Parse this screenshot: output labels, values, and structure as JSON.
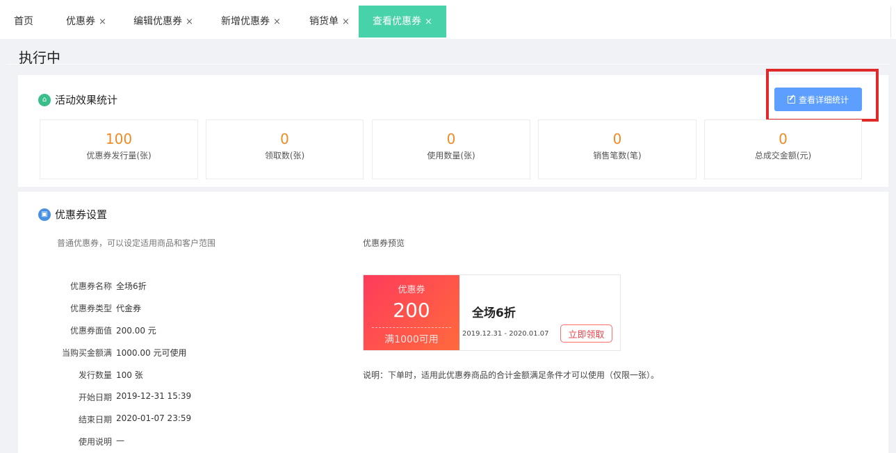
{
  "tabs": [
    {
      "label": "首页",
      "closable": false,
      "active": false
    },
    {
      "label": "优惠券",
      "closable": true,
      "active": false
    },
    {
      "label": "编辑优惠券",
      "closable": true,
      "active": false
    },
    {
      "label": "新增优惠券",
      "closable": true,
      "active": false
    },
    {
      "label": "销货单",
      "closable": true,
      "active": false
    },
    {
      "label": "查看优惠券",
      "closable": true,
      "active": true
    }
  ],
  "close_glyph": "×",
  "page_title": "执行中",
  "stats_section": {
    "title": "活动效果统计",
    "icon": "home-icon",
    "detail_button_label": "查看详细统计",
    "items": [
      {
        "value": "100",
        "label": "优惠券发行量(张)"
      },
      {
        "value": "0",
        "label": "领取数(张)"
      },
      {
        "value": "0",
        "label": "使用数量(张)"
      },
      {
        "value": "0",
        "label": "销售笔数(笔)"
      },
      {
        "value": "0",
        "label": "总成交金额(元)"
      }
    ]
  },
  "settings_section": {
    "title": "优惠券设置",
    "icon": "coupon-icon",
    "description": "普通优惠券，可以设定适用商品和客户范围",
    "preview_label": "优惠券预览",
    "fields": [
      {
        "key": "优惠券名称",
        "value": "全场6折"
      },
      {
        "key": "优惠券类型",
        "value": "代金券"
      },
      {
        "key": "优惠券面值",
        "value": "200.00 元"
      },
      {
        "key": "当购买金额满",
        "value": "1000.00 元可使用"
      },
      {
        "key": "发行数量",
        "value": "100 张"
      },
      {
        "key": "开始日期",
        "value": "2019-12-31 15:39"
      },
      {
        "key": "结束日期",
        "value": "2020-01-07 23:59"
      },
      {
        "key": "使用说明",
        "value": "—"
      }
    ]
  },
  "coupon_preview": {
    "tag": "优惠券",
    "amount": "200",
    "condition": "满1000可用",
    "name": "全场6折",
    "date_range": "2019.12.31 - 2020.01.07",
    "claim_label": "立即领取",
    "note": "说明：下单时，适用此优惠券商品的合计金额满足条件才可以使用（仅限一张）。"
  },
  "colors": {
    "accent_tab": "#48d2a9",
    "stat_value": "#f08a24",
    "primary_button": "#5c9fff",
    "highlight": "#e02a2a",
    "coupon_red": "#ff3b5c"
  }
}
